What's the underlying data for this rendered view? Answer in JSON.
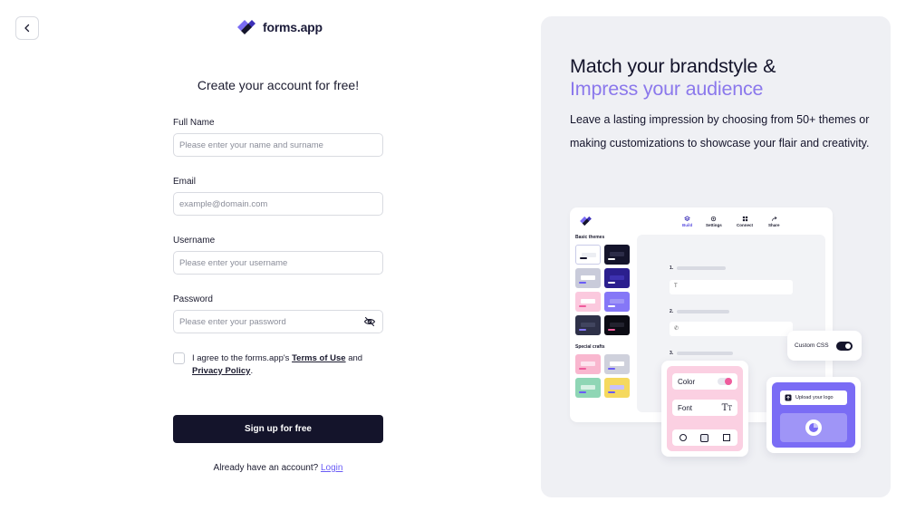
{
  "brand": {
    "name": "forms.app",
    "accent": "#6a5cf6",
    "dark": "#14142b"
  },
  "form": {
    "title": "Create your account for free!",
    "fields": {
      "full_name": {
        "label": "Full Name",
        "placeholder": "Please enter your name and surname",
        "value": ""
      },
      "email": {
        "label": "Email",
        "placeholder": "example@domain.com",
        "value": ""
      },
      "username": {
        "label": "Username",
        "placeholder": "Please enter your username",
        "value": ""
      },
      "password": {
        "label": "Password",
        "placeholder": "Please enter your password",
        "value": ""
      }
    },
    "agree": {
      "prefix": "I agree to the forms.app's ",
      "terms": "Terms of Use",
      "middle": " and",
      "privacy": "Privacy Policy",
      "suffix": "."
    },
    "submit_label": "Sign up for free",
    "login_prompt": "Already have an account?",
    "login_link": "Login"
  },
  "promo": {
    "headline_line1": "Match your brandstyle &",
    "headline_line2": "Impress your audience",
    "description": "Leave a lasting impression by choosing from 50+ themes or making customizations to showcase your flair and creativity.",
    "mockup": {
      "nav": [
        "Build",
        "Settings",
        "Connect",
        "Share"
      ],
      "basic_themes_label": "Basic themes",
      "special_crafts_label": "Special crafts",
      "question_numbers": [
        "1.",
        "2.",
        "3."
      ],
      "color_label": "Color",
      "font_label": "Font",
      "custom_css_label": "Custom CSS",
      "upload_logo_label": "Upload your logo"
    }
  }
}
